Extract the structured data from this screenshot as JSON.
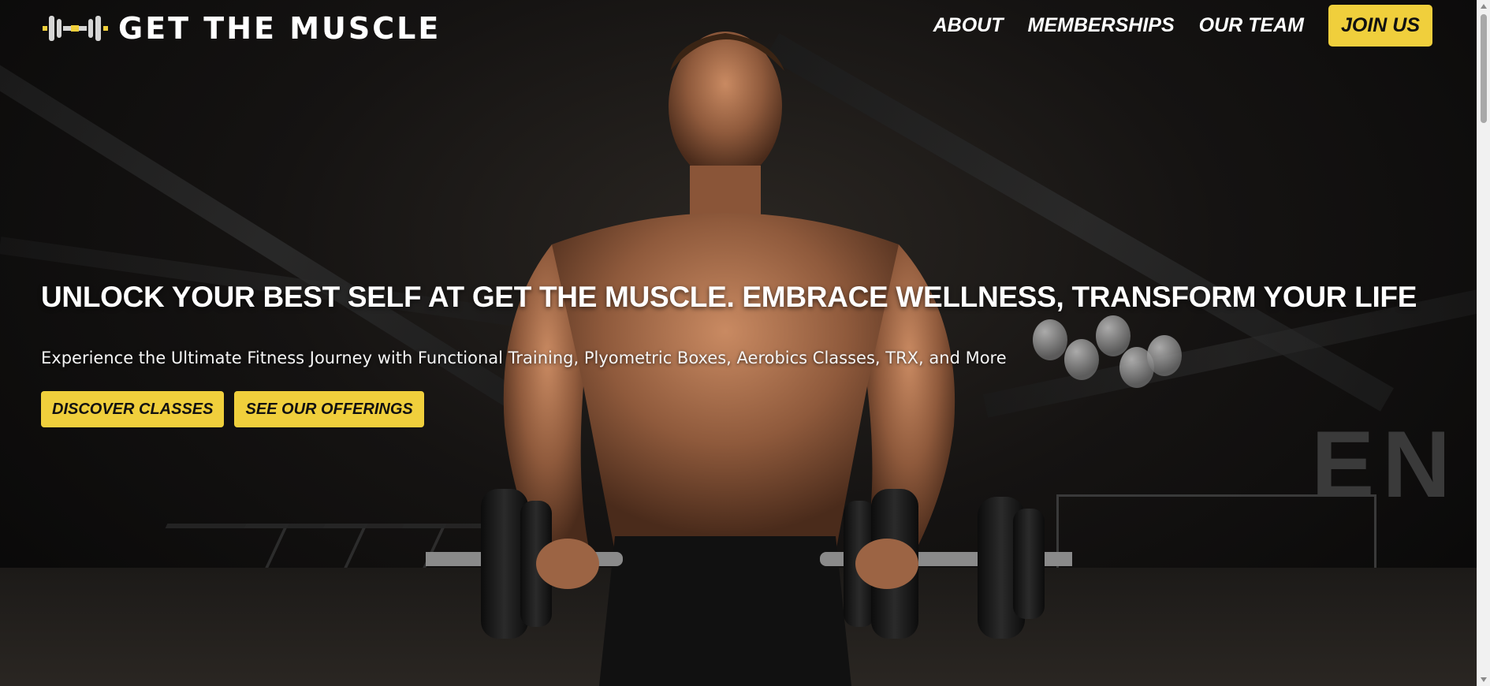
{
  "brand": {
    "name": "GET THE MUSCLE",
    "logo_icon": "dumbbell-icon"
  },
  "nav": {
    "items": [
      {
        "label": "ABOUT"
      },
      {
        "label": "MEMBERSHIPS"
      },
      {
        "label": "OUR TEAM"
      }
    ],
    "cta_label": "JOIN US"
  },
  "hero": {
    "headline": "UNLOCK YOUR BEST SELF AT GET THE MUSCLE. EMBRACE WELLNESS, TRANSFORM YOUR LIFE",
    "subtitle": "Experience the Ultimate Fitness Journey with Functional Training, Plyometric Boxes, Aerobics Classes, TRX, and More",
    "buttons": [
      {
        "label": "DISCOVER CLASSES"
      },
      {
        "label": "SEE OUR OFFERINGS"
      }
    ]
  },
  "colors": {
    "accent": "#f0cf3c",
    "text": "#ffffff",
    "background": "#0b0b0b"
  }
}
